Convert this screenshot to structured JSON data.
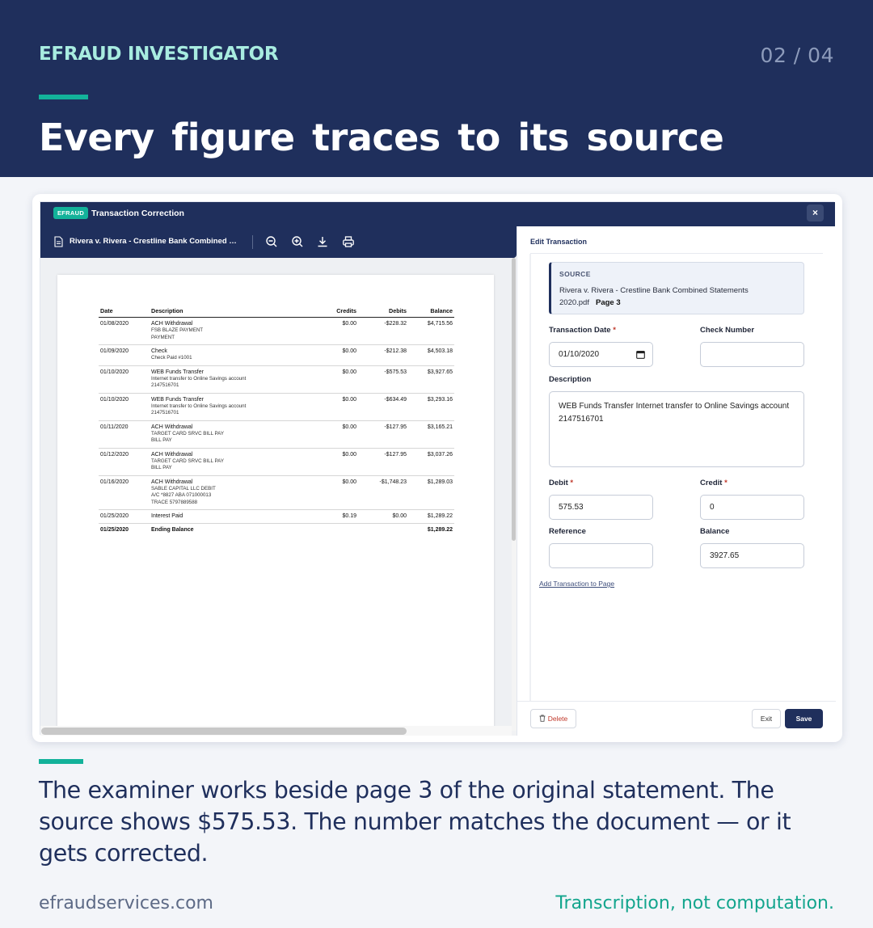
{
  "header": {
    "brand": "EFRAUD INVESTIGATOR",
    "page_counter": "02 / 04",
    "headline": "Every figure traces to its source"
  },
  "app": {
    "badge": "EFRAUD",
    "title": "Transaction Correction",
    "close_label": "×"
  },
  "viewer": {
    "document_name": "Rivera v. Rivera - Crestline Bank Combined Statements 2020.pdf",
    "toolbar_icons": [
      "zoom-out-icon",
      "zoom-in-icon",
      "download-icon",
      "print-icon"
    ],
    "columns": [
      "Date",
      "Description",
      "Credits",
      "Debits",
      "Balance"
    ],
    "rows": [
      {
        "date": "01/08/2020",
        "desc": "ACH Withdrawal",
        "sub": [
          "FSB BLAZE PAYMENT",
          "PAYMENT"
        ],
        "credit": "$0.00",
        "debit": "-$228.32",
        "balance": "$4,715.56"
      },
      {
        "date": "01/09/2020",
        "desc": "Check",
        "sub": [
          "Check Paid #1001"
        ],
        "credit": "$0.00",
        "debit": "-$212.38",
        "balance": "$4,503.18"
      },
      {
        "date": "01/10/2020",
        "desc": "WEB Funds Transfer",
        "sub": [
          "Internet transfer to Online Savings account",
          "2147516701"
        ],
        "credit": "$0.00",
        "debit": "-$575.53",
        "balance": "$3,927.65"
      },
      {
        "date": "01/10/2020",
        "desc": "WEB Funds Transfer",
        "sub": [
          "Internet transfer to Online Savings account",
          "2147516701"
        ],
        "credit": "$0.00",
        "debit": "-$634.49",
        "balance": "$3,293.16"
      },
      {
        "date": "01/11/2020",
        "desc": "ACH Withdrawal",
        "sub": [
          "TARGET CARD SRVC BILL PAY",
          "BILL PAY"
        ],
        "credit": "$0.00",
        "debit": "-$127.95",
        "balance": "$3,165.21"
      },
      {
        "date": "01/12/2020",
        "desc": "ACH Withdrawal",
        "sub": [
          "TARGET CARD SRVC BILL PAY",
          "BILL PAY"
        ],
        "credit": "$0.00",
        "debit": "-$127.95",
        "balance": "$3,037.26"
      },
      {
        "date": "01/16/2020",
        "desc": "ACH Withdrawal",
        "sub": [
          "SABLE CAPITAL LLC DEBIT",
          "A/C *8827 ABA 071000013",
          "TRACE 5797889588"
        ],
        "credit": "$0.00",
        "debit": "-$1,748.23",
        "balance": "$1,289.03"
      },
      {
        "date": "01/25/2020",
        "desc": "Interest Paid",
        "sub": [],
        "credit": "$0.19",
        "debit": "$0.00",
        "balance": "$1,289.22"
      },
      {
        "date": "01/25/2020",
        "desc": "Ending Balance",
        "sub": [],
        "credit": "",
        "debit": "",
        "balance": "$1,289.22",
        "bold": true
      }
    ]
  },
  "editor": {
    "title": "Edit Transaction",
    "source_label": "SOURCE",
    "source_file": "Rivera v. Rivera - Crestline Bank Combined Statements 2020.pdf",
    "source_page": "Page 3",
    "fields": {
      "transaction_date_label": "Transaction Date",
      "transaction_date_value": "01/10/2020",
      "check_number_label": "Check Number",
      "check_number_value": "",
      "description_label": "Description",
      "description_value": "WEB Funds Transfer Internet transfer to Online Savings account 2147516701",
      "debit_label": "Debit",
      "debit_value": "575.53",
      "credit_label": "Credit",
      "credit_value": "0",
      "reference_label": "Reference",
      "reference_value": "",
      "balance_label": "Balance",
      "balance_value": "3927.65",
      "required_mark": "*"
    },
    "add_link": "Add Transaction to Page",
    "buttons": {
      "delete": "Delete",
      "exit": "Exit",
      "save": "Save"
    }
  },
  "body": {
    "copy": "The examiner works beside page 3 of the original statement. The source shows $575.53. The number matches the document — or it gets corrected."
  },
  "footer": {
    "url": "efraudservices.com",
    "tagline": "Transcription, not computation."
  },
  "colors": {
    "navy": "#1f2f5c",
    "teal": "#13b29a",
    "mint": "#a8ece0",
    "required": "#c0392b"
  }
}
